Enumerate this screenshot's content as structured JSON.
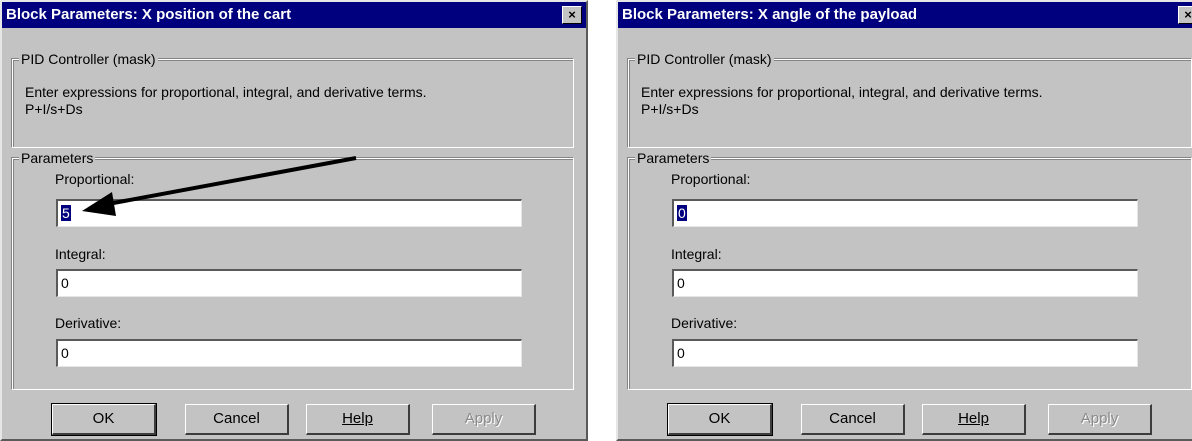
{
  "dialogs": [
    {
      "title": "Block Parameters: X position of  the cart",
      "close_glyph": "×",
      "mask_group": "PID Controller (mask)",
      "description_line1": "Enter expressions for proportional, integral, and derivative terms.",
      "description_line2": "P+I/s+Ds",
      "params_group": "Parameters",
      "proportional_label": "Proportional:",
      "proportional_value": "5",
      "integral_label": "Integral:",
      "integral_value": "0",
      "derivative_label": "Derivative:",
      "derivative_value": "0",
      "ok_label": "OK",
      "cancel_label": "Cancel",
      "help_label": "Help",
      "apply_label": "Apply"
    },
    {
      "title": "Block Parameters: X angle of the payload",
      "close_glyph": "×",
      "mask_group": "PID Controller (mask)",
      "description_line1": "Enter expressions for proportional, integral, and derivative terms.",
      "description_line2": "P+I/s+Ds",
      "params_group": "Parameters",
      "proportional_label": "Proportional:",
      "proportional_value": "0",
      "integral_label": "Integral:",
      "integral_value": "0",
      "derivative_label": "Derivative:",
      "derivative_value": "0",
      "ok_label": "OK",
      "cancel_label": "Cancel",
      "help_label": "Help",
      "apply_label": "Apply"
    }
  ],
  "colors": {
    "dialog_bg": "#c3c3c3",
    "titlebar": "#00007f",
    "selection": "#00007f",
    "annotation_arrow": "#000000"
  },
  "annotation": {
    "type": "arrow-icon",
    "points_to": "proportional-field"
  }
}
